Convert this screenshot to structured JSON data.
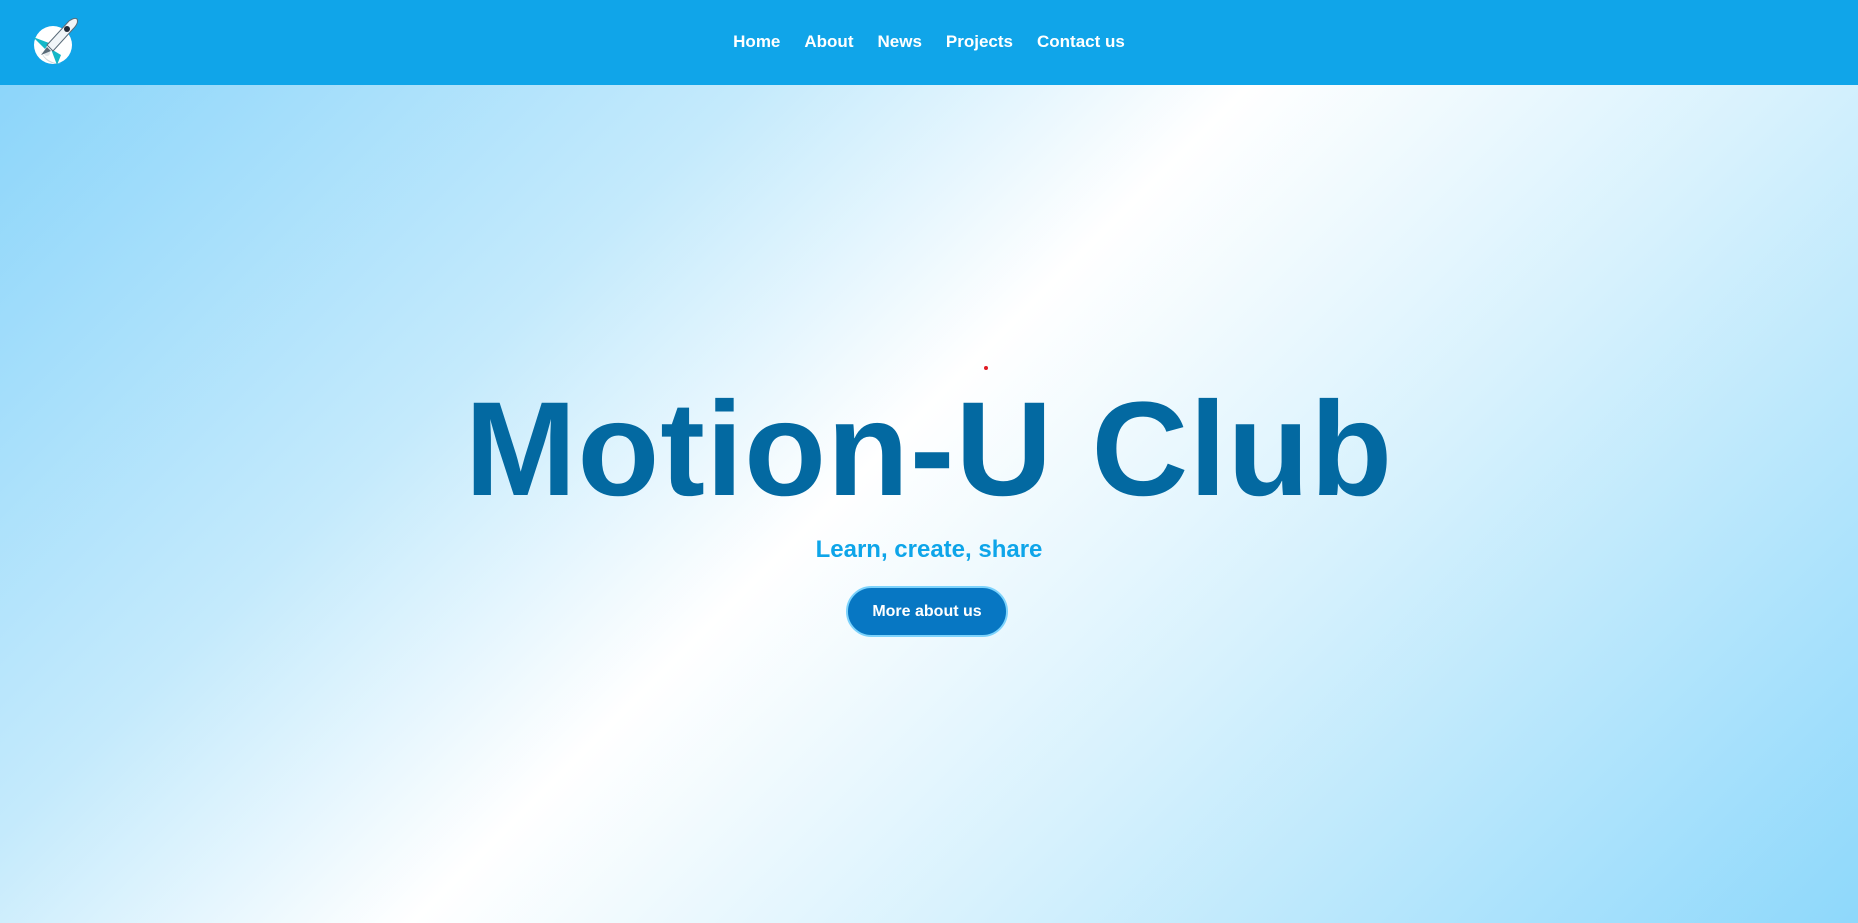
{
  "navbar": {
    "logo_icon": "rocket-moon-logo-icon",
    "links": [
      "Home",
      "About",
      "News",
      "Projects",
      "Contact us"
    ]
  },
  "hero": {
    "title": "Motion-U Club",
    "subtitle": "Learn, create, share",
    "button_label": "More about us"
  },
  "colors": {
    "navbar_bg": "#10a5e9",
    "title": "#0369a1",
    "subtitle": "#0ea5e9",
    "button_bg": "#0777c3",
    "button_border": "#7dd3fc",
    "accent_dot": "#e01b24"
  }
}
